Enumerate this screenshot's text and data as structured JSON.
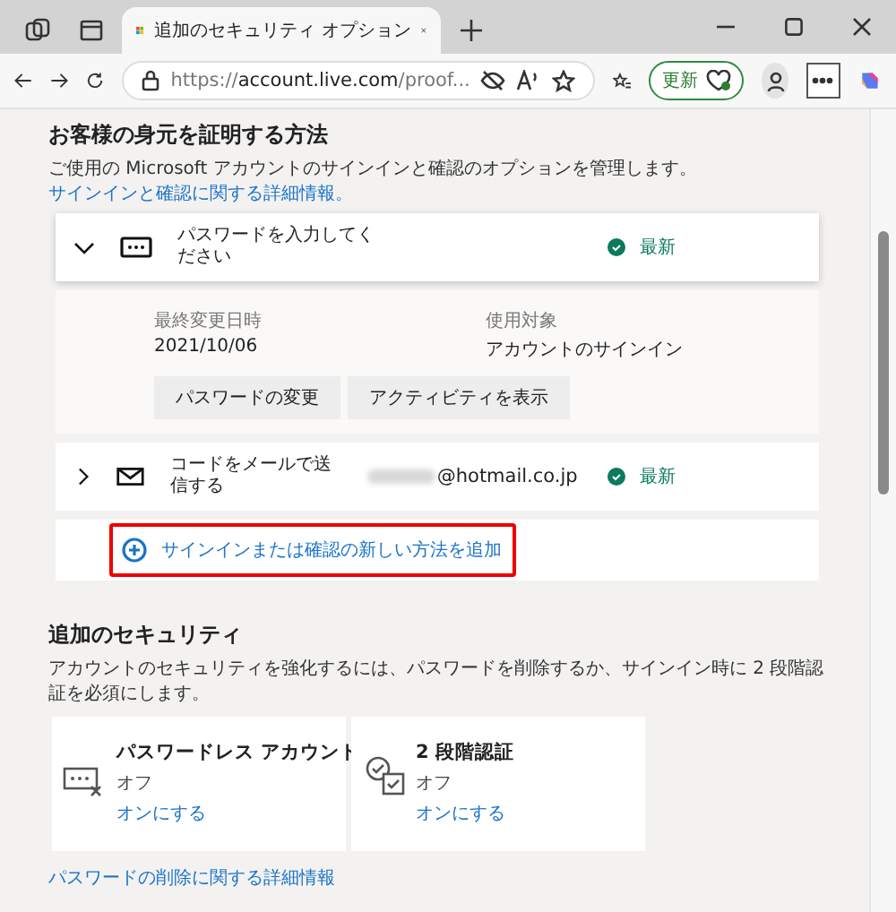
{
  "browser": {
    "tab_title": "追加のセキュリティ オプション",
    "url_scheme": "https://",
    "url_host": "account.live.com",
    "url_path": "/proof...",
    "update_label": "更新"
  },
  "identity": {
    "heading": "お客様の身元を証明する方法",
    "description": "ご使用の Microsoft アカウントのサインインと確認のオプションを管理します。",
    "link": "サインインと確認に関する詳細情報。",
    "methods": [
      {
        "kind": "password",
        "title": "パスワードを入力してください",
        "expanded": true,
        "status": "最新",
        "details": [
          {
            "label": "最終変更日時",
            "value": "2021/10/06"
          },
          {
            "label": "使用対象",
            "value": "アカウントのサインイン"
          }
        ],
        "actions": [
          "パスワードの変更",
          "アクティビティを表示"
        ]
      },
      {
        "kind": "email",
        "title": "コードをメールで送信する",
        "expanded": false,
        "address": "@hotmail.co.jp",
        "status": "最新"
      }
    ],
    "add_link": {
      "label": "サインインまたは確認の新しい方法を追加",
      "highlighted": true
    }
  },
  "additional": {
    "heading": "追加のセキュリティ",
    "description": "アカウントのセキュリティを強化するには、パスワードを削除するか、サインイン時に 2 段階認証を必須にします。",
    "options": [
      {
        "kind": "passwordless",
        "title": "パスワードレス アカウント",
        "state": "オフ",
        "action": "オンにする"
      },
      {
        "kind": "two_step",
        "title": "2 段階認証",
        "state": "オフ",
        "action": "オンにする"
      }
    ],
    "links": [
      "パスワードの削除に関する詳細情報"
    ]
  }
}
